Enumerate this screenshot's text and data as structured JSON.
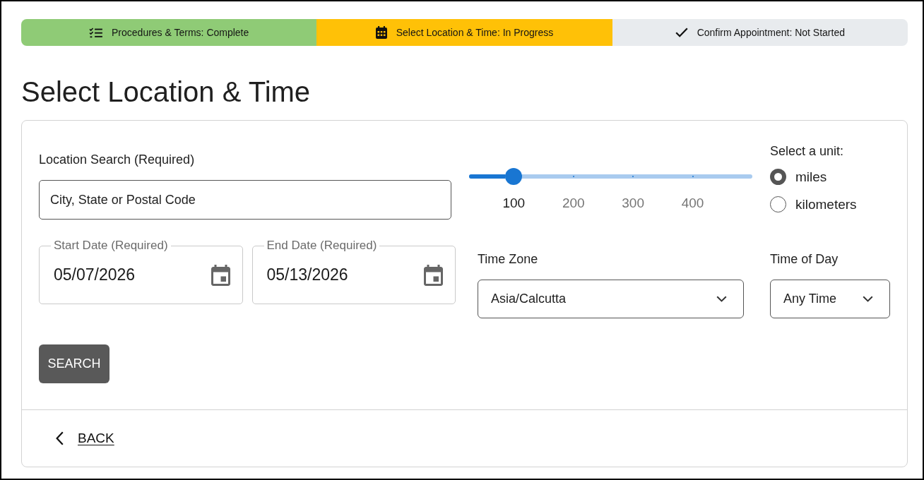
{
  "progress_steps": [
    {
      "label": "Procedures & Terms: Complete",
      "color": "#8fcb76"
    },
    {
      "label": "Select Location & Time: In Progress",
      "color": "#ffc107"
    },
    {
      "label": "Confirm Appointment: Not Started",
      "color": "#e8ebee"
    }
  ],
  "title": "Select Location & Time",
  "form": {
    "location_search": {
      "label": "Location Search (Required)",
      "placeholder": "City, State or Postal Code"
    },
    "distance": {
      "level": 0.157,
      "marks": [
        {
          "label": "100",
          "selected": true
        },
        {
          "label": "200",
          "selected": false
        },
        {
          "label": "300",
          "selected": false
        },
        {
          "label": "400",
          "selected": false
        }
      ]
    },
    "unit": {
      "label": "Select a unit:",
      "options": [
        {
          "label": "miles",
          "selected": true
        },
        {
          "label": "kilometers",
          "selected": false
        }
      ]
    },
    "start_date": {
      "label": "Start Date (Required)",
      "value": "05/07/2026"
    },
    "end_date": {
      "label": "End Date (Required)",
      "value": "05/13/2026"
    },
    "time_zone": {
      "label": "Time Zone",
      "value": "Asia/Calcutta"
    },
    "time_of_day": {
      "label": "Time of Day",
      "value": "Any Time"
    },
    "search_button": "SEARCH"
  },
  "back_link": "BACK"
}
